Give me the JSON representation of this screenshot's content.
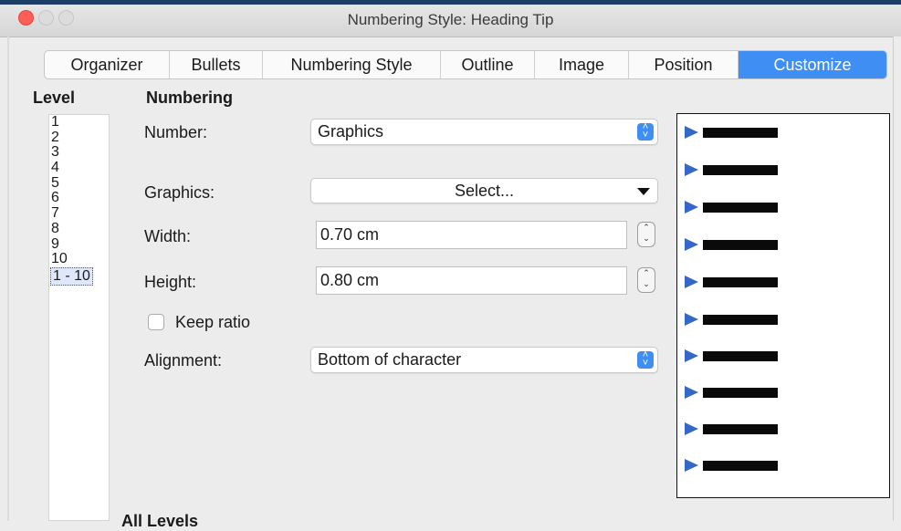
{
  "window": {
    "title": "Numbering Style: Heading Tip"
  },
  "tabs": [
    {
      "label": "Organizer"
    },
    {
      "label": "Bullets"
    },
    {
      "label": "Numbering Style"
    },
    {
      "label": "Outline"
    },
    {
      "label": "Image"
    },
    {
      "label": "Position"
    },
    {
      "label": "Customize",
      "active": true
    }
  ],
  "level": {
    "heading": "Level",
    "items": [
      "1",
      "2",
      "3",
      "4",
      "5",
      "6",
      "7",
      "8",
      "9",
      "10",
      "1 - 10"
    ],
    "selected": "1 - 10"
  },
  "numbering": {
    "heading": "Numbering",
    "number_label": "Number:",
    "number_value": "Graphics",
    "graphics_label": "Graphics:",
    "graphics_button": "Select...",
    "width_label": "Width:",
    "width_value": "0.70 cm",
    "height_label": "Height:",
    "height_value": "0.80 cm",
    "keep_ratio_label": "Keep ratio",
    "keep_ratio_checked": false,
    "alignment_label": "Alignment:",
    "alignment_value": "Bottom of character"
  },
  "preview": {
    "rows": 10,
    "bullet_icon": "blue-triangle-arrow",
    "bullet_color": "#3567c8"
  },
  "footer": {
    "all_levels": "All Levels"
  },
  "colors": {
    "accent": "#3f8ef3",
    "close_button": "#fc5f58"
  }
}
